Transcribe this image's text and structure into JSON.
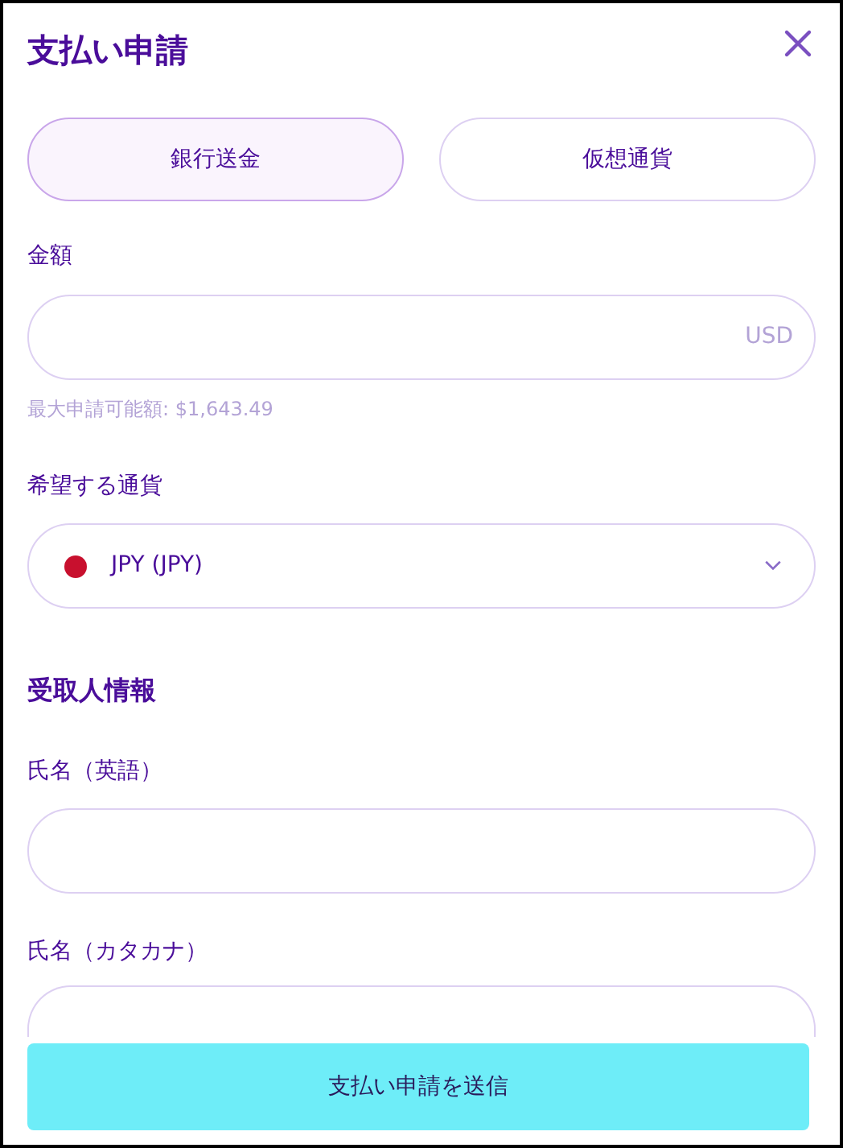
{
  "title": "支払い申請",
  "tabs": [
    {
      "label": "銀行送金",
      "selected": true
    },
    {
      "label": "仮想通貨",
      "selected": false
    }
  ],
  "amount": {
    "label": "金額",
    "suffix": "USD",
    "hint": "最大申請可能額: $1,643.49"
  },
  "currency": {
    "label": "希望する通貨",
    "value": "JPY (JPY)"
  },
  "recipient": {
    "heading": "受取人情報",
    "fields": [
      {
        "label": "氏名（英語）"
      },
      {
        "label": "氏名（カタカナ）"
      }
    ]
  },
  "submit": "支払い申請を送信"
}
